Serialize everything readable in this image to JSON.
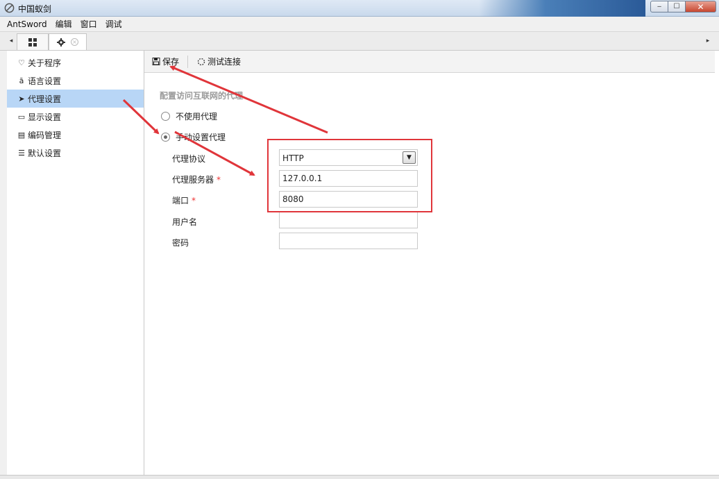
{
  "window": {
    "title": "中国蚁剑",
    "minimize_label": "‒",
    "maximize_label": "☐",
    "close_label": "✕"
  },
  "menubar": {
    "items": [
      "AntSword",
      "编辑",
      "窗口",
      "调试"
    ]
  },
  "tabs": {
    "left_arrow": "◂",
    "right_arrow": "▸",
    "close_glyph": "×"
  },
  "sidebar": {
    "items": [
      {
        "label": "关于程序",
        "icon": "heart-icon",
        "glyph": "♡"
      },
      {
        "label": "语言设置",
        "icon": "language-icon",
        "glyph": "ā"
      },
      {
        "label": "代理设置",
        "icon": "paper-plane-icon",
        "glyph": "➤"
      },
      {
        "label": "显示设置",
        "icon": "monitor-icon",
        "glyph": "▭"
      },
      {
        "label": "编码管理",
        "icon": "file-icon",
        "glyph": "▤"
      },
      {
        "label": "默认设置",
        "icon": "sliders-icon",
        "glyph": "☰"
      }
    ],
    "active_index": 2
  },
  "toolbar": {
    "save_label": "保存",
    "test_label": "测试连接"
  },
  "proxy_form": {
    "legend": "配置访问互联网的代理",
    "no_proxy_label": "不使用代理",
    "manual_proxy_label": "手动设置代理",
    "selected_mode": "manual",
    "protocol_label": "代理协议",
    "protocol_value": "HTTP",
    "server_label": "代理服务器",
    "server_value": "127.0.0.1",
    "port_label": "端口",
    "port_value": "8080",
    "username_label": "用户名",
    "username_value": "",
    "password_label": "密码",
    "password_value": "",
    "required_mark": "*"
  },
  "colors": {
    "accent_active": "#b8d6f6",
    "annotation_red": "#e0353a",
    "required_red": "#ee3333"
  }
}
